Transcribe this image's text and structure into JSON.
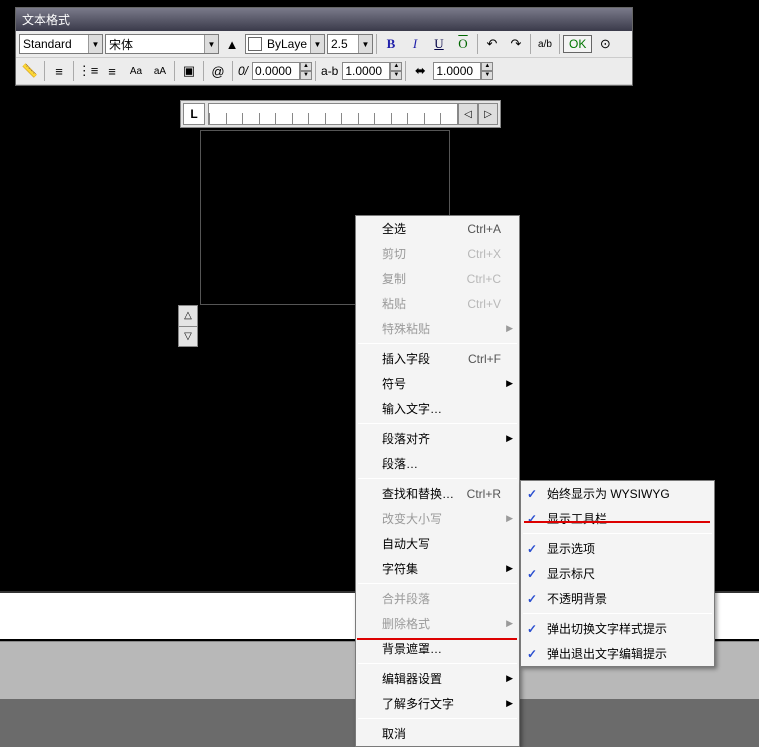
{
  "titlebar": {
    "text": "文本格式"
  },
  "toolbar": {
    "style": "Standard",
    "font": "宋体",
    "layer": "ByLayer",
    "height": "2.5",
    "ok": "OK",
    "tracking": "1.0000",
    "widthfactor": "1.0000",
    "ab_label": "a-b",
    "at_label": "0.0000"
  },
  "ruler": {
    "btn": "L"
  },
  "main_menu": {
    "items": [
      {
        "label": "全选",
        "shortcut": "Ctrl+A",
        "enabled": true
      },
      {
        "label": "剪切",
        "shortcut": "Ctrl+X",
        "enabled": false
      },
      {
        "label": "复制",
        "shortcut": "Ctrl+C",
        "enabled": false
      },
      {
        "label": "粘贴",
        "shortcut": "Ctrl+V",
        "enabled": false
      },
      {
        "label": "特殊粘贴",
        "submenu": true,
        "enabled": false
      },
      {
        "sep": true
      },
      {
        "label": "插入字段",
        "shortcut": "Ctrl+F",
        "enabled": true
      },
      {
        "label": "符号",
        "submenu": true,
        "enabled": true
      },
      {
        "label": "输入文字…",
        "enabled": true
      },
      {
        "sep": true
      },
      {
        "label": "段落对齐",
        "submenu": true,
        "enabled": true
      },
      {
        "label": "段落…",
        "enabled": true
      },
      {
        "sep": true
      },
      {
        "label": "查找和替换…",
        "shortcut": "Ctrl+R",
        "enabled": true
      },
      {
        "label": "改变大小写",
        "submenu": true,
        "enabled": false
      },
      {
        "label": "自动大写",
        "enabled": true
      },
      {
        "label": "字符集",
        "submenu": true,
        "enabled": true
      },
      {
        "sep": true
      },
      {
        "label": "合并段落",
        "enabled": false
      },
      {
        "label": "删除格式",
        "submenu": true,
        "enabled": false
      },
      {
        "label": "背景遮罩…",
        "enabled": true
      },
      {
        "sep": true
      },
      {
        "label": "编辑器设置",
        "submenu": true,
        "enabled": true,
        "highlight": true
      },
      {
        "label": "了解多行文字",
        "submenu": true,
        "enabled": true
      },
      {
        "sep": true
      },
      {
        "label": "取消",
        "enabled": true
      }
    ]
  },
  "sub_menu": {
    "items": [
      {
        "label": "始终显示为 WYSIWYG",
        "checked": true
      },
      {
        "label": "显示工具栏",
        "checked": true,
        "highlight": true
      },
      {
        "sep": true
      },
      {
        "label": "显示选项",
        "checked": true
      },
      {
        "label": "显示标尺",
        "checked": true
      },
      {
        "label": "不透明背景",
        "checked": true
      },
      {
        "sep": true
      },
      {
        "label": "弹出切换文字样式提示",
        "checked": true
      },
      {
        "label": "弹出退出文字编辑提示",
        "checked": true
      }
    ]
  }
}
